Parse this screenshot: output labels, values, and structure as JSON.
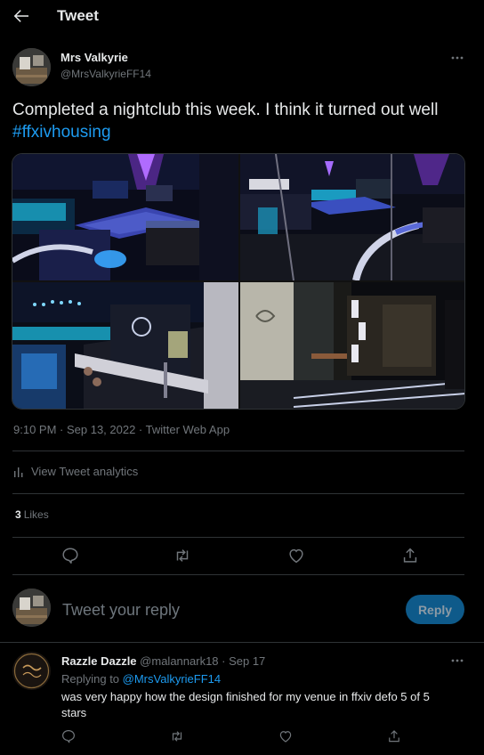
{
  "header": {
    "title": "Tweet"
  },
  "tweet": {
    "author_name": "Mrs Valkyrie",
    "author_handle": "@MrsValkyrieFF14",
    "text": "Completed a nightclub this week. I think it turned out well ",
    "hashtag": "#ffxivhousing",
    "timestamp": "9:10 PM · Sep 13, 2022 · Twitter Web App",
    "analytics_label": "View Tweet analytics",
    "likes_count": "3",
    "likes_label": "Likes"
  },
  "reply_box": {
    "placeholder": "Tweet your reply",
    "button_label": "Reply"
  },
  "reply": {
    "name": "Razzle Dazzle",
    "handle_date": "@malannark18 · Sep 17",
    "replying_prefix": "Replying to ",
    "replying_to": "@MrsValkyrieFF14",
    "text": "was very happy how the design finished for my venue in ffxiv defo 5 of 5 stars"
  },
  "colors": {
    "accent": "#1d9bf0",
    "background": "#000000",
    "divider": "#2f3336",
    "muted": "#71767b"
  },
  "icons": [
    "back-arrow-icon",
    "more-icon",
    "analytics-icon",
    "reply-icon",
    "retweet-icon",
    "like-icon",
    "share-icon"
  ]
}
